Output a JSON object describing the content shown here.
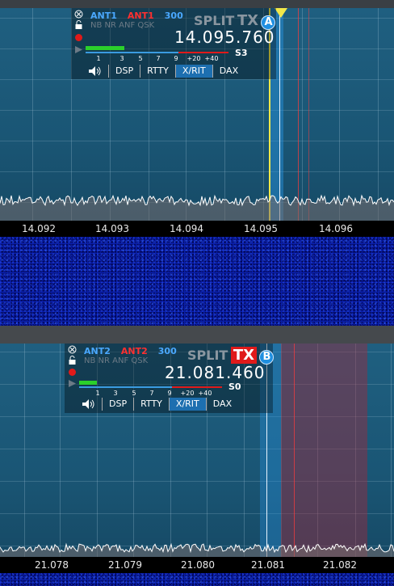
{
  "colors": {
    "accent": "#1f8fe0",
    "tx_red": "#e01a1a",
    "ant_blue": "#4aa8ff",
    "waterfall": "#0a1fa8"
  },
  "panadapter_a": {
    "scale_ticks": [
      "14.092",
      "14.093",
      "14.094",
      "14.095",
      "14.096"
    ],
    "slice": {
      "rx_ant": "ANT1",
      "tx_ant": "ANT1",
      "bandwidth": "300",
      "dsp_flags": "NB NR ANF QSK",
      "split_label": "SPLIT",
      "tx_label": "TX",
      "letter": "A",
      "frequency": "14.095.760",
      "meter_ticks": [
        "1",
        "3",
        "5",
        "7",
        "9",
        "+20",
        "+40"
      ],
      "s_reading": "S3",
      "s_level": 0.27,
      "tabs": [
        "DSP",
        "RTTY",
        "X/RIT",
        "DAX"
      ],
      "active_tab": "X/RIT"
    }
  },
  "panadapter_b": {
    "scale_ticks": [
      "21.078",
      "21.079",
      "21.080",
      "21.081",
      "21.082"
    ],
    "slice": {
      "rx_ant": "ANT2",
      "tx_ant": "ANT2",
      "bandwidth": "300",
      "dsp_flags": "NB NR ANF QSK",
      "split_label": "SPLIT",
      "tx_label": "TX",
      "letter": "B",
      "frequency": "21.081.460",
      "meter_ticks": [
        "1",
        "3",
        "5",
        "7",
        "9",
        "+20",
        "+40"
      ],
      "s_reading": "S0",
      "s_level": 0.15,
      "tabs": [
        "DSP",
        "RTTY",
        "X/RIT",
        "DAX"
      ],
      "active_tab": "X/RIT"
    }
  }
}
